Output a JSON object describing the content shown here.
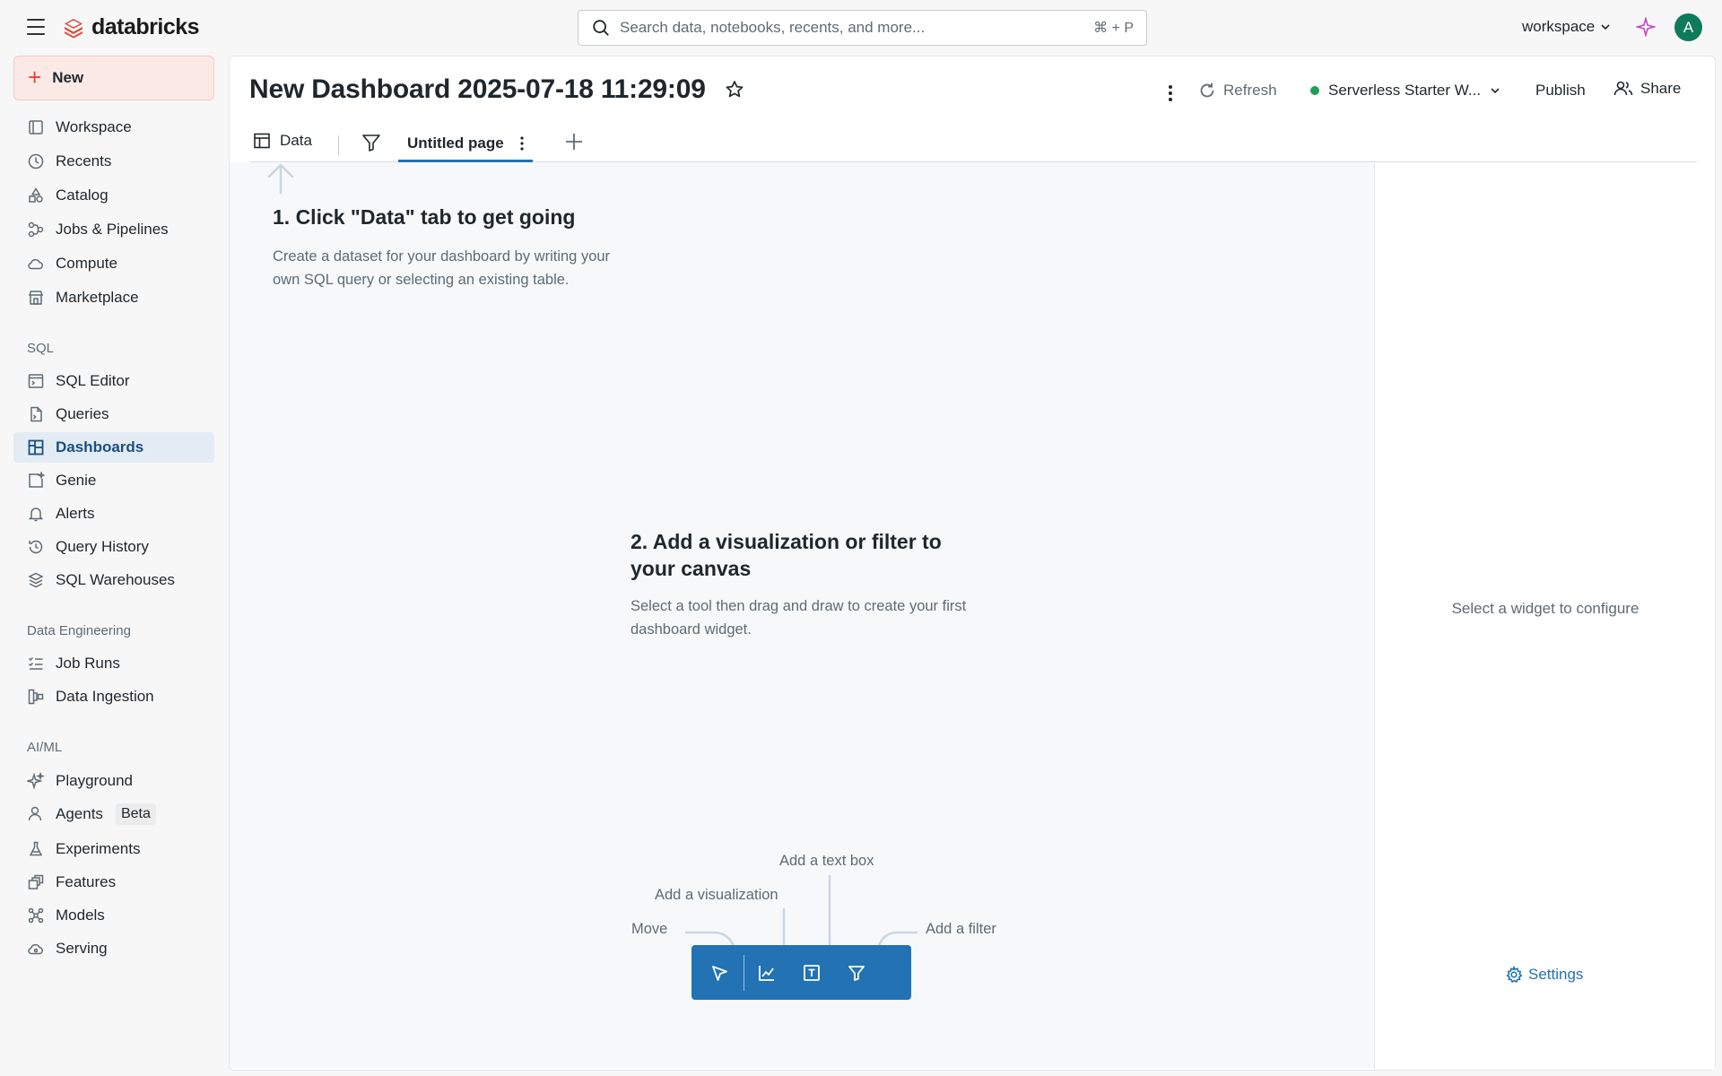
{
  "brand": {
    "name": "databricks"
  },
  "search": {
    "placeholder": "Search data, notebooks, recents, and more...",
    "shortcut": "⌘ + P"
  },
  "workspace_switcher": {
    "label": "workspace"
  },
  "user": {
    "initial": "A",
    "avatar_color": "#0f7a5c"
  },
  "sidebar": {
    "new_label": "New",
    "items": [
      {
        "label": "Workspace",
        "icon": "workspace-icon"
      },
      {
        "label": "Recents",
        "icon": "clock-icon"
      },
      {
        "label": "Catalog",
        "icon": "catalog-icon"
      },
      {
        "label": "Jobs & Pipelines",
        "icon": "workflow-icon"
      },
      {
        "label": "Compute",
        "icon": "cloud-icon"
      },
      {
        "label": "Marketplace",
        "icon": "store-icon"
      }
    ],
    "sql_section": "SQL",
    "sql_items": [
      {
        "label": "SQL Editor",
        "icon": "sql-editor-icon"
      },
      {
        "label": "Queries",
        "icon": "query-file-icon"
      },
      {
        "label": "Dashboards",
        "icon": "dashboard-icon",
        "active": true
      },
      {
        "label": "Genie",
        "icon": "genie-icon"
      },
      {
        "label": "Alerts",
        "icon": "bell-icon"
      },
      {
        "label": "Query History",
        "icon": "history-icon"
      },
      {
        "label": "SQL Warehouses",
        "icon": "warehouse-icon"
      }
    ],
    "de_section": "Data Engineering",
    "de_items": [
      {
        "label": "Job Runs",
        "icon": "list-check-icon"
      },
      {
        "label": "Data Ingestion",
        "icon": "ingestion-icon"
      }
    ],
    "ml_section": "AI/ML",
    "ml_items": [
      {
        "label": "Playground",
        "icon": "sparkle-icon"
      },
      {
        "label": "Agents",
        "icon": "agent-icon",
        "badge": "Beta"
      },
      {
        "label": "Experiments",
        "icon": "flask-icon"
      },
      {
        "label": "Features",
        "icon": "features-icon"
      },
      {
        "label": "Models",
        "icon": "models-icon"
      },
      {
        "label": "Serving",
        "icon": "serving-icon"
      }
    ]
  },
  "dashboard": {
    "title": "New Dashboard 2025-07-18 11:29:09",
    "refresh_label": "Refresh",
    "warehouse_label": "Serverless Starter W...",
    "warehouse_status_color": "#1f9f57",
    "publish_label": "Publish",
    "share_label": "Share",
    "tabs": {
      "data_label": "Data",
      "page_label": "Untitled page"
    }
  },
  "canvas": {
    "step1_title": "1. Click \"Data\" tab to get going",
    "step1_desc": "Create a dataset for your dashboard by writing your own SQL query or selecting an existing table.",
    "step2_title": "2. Add a visualization or filter to your canvas",
    "step2_desc": "Select a tool then drag and draw to create your first dashboard widget.",
    "hints": {
      "move": "Move",
      "visualization": "Add a visualization",
      "textbox": "Add a text box",
      "filter": "Add a filter"
    }
  },
  "config_panel": {
    "hint": "Select a widget to configure",
    "settings_label": "Settings"
  },
  "colors": {
    "accent": "#2272b4",
    "brand_red": "#e0493a"
  }
}
